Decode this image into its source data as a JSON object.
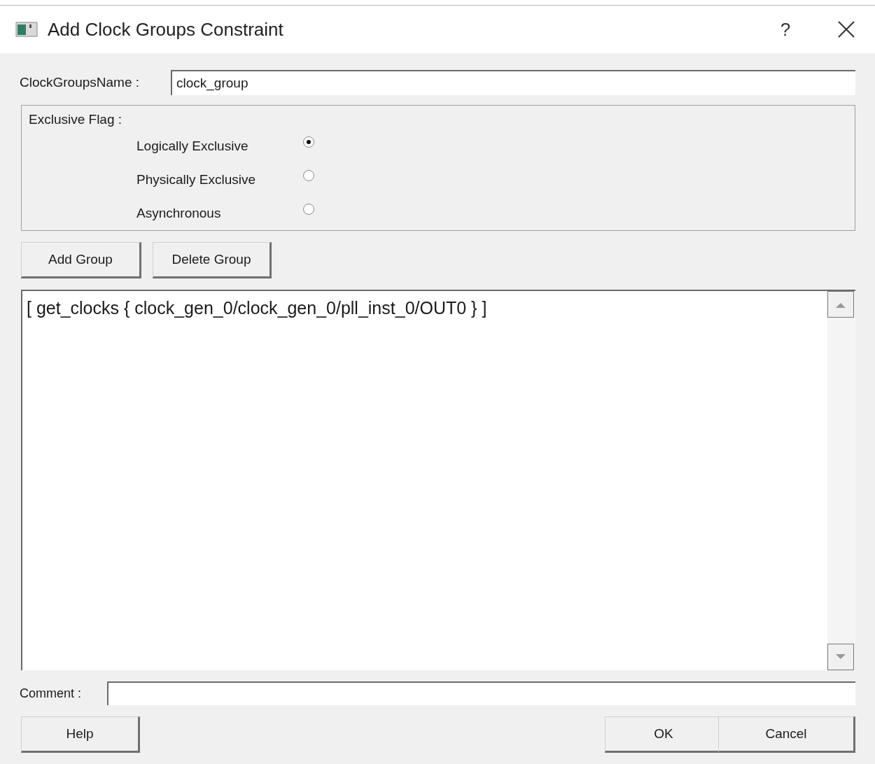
{
  "window": {
    "title": "Add Clock Groups Constraint",
    "help": "?"
  },
  "name_field": {
    "label": "ClockGroupsName :",
    "value": "clock_group"
  },
  "exclusive_flag": {
    "label": "Exclusive Flag :",
    "options": [
      {
        "label": "Logically Exclusive",
        "selected": true
      },
      {
        "label": "Physically Exclusive",
        "selected": false
      },
      {
        "label": "Asynchronous",
        "selected": false
      }
    ]
  },
  "group_buttons": [
    "Add Group",
    "Delete Group"
  ],
  "groups": [
    "[ get_clocks { clock_gen_0/clock_gen_0/pll_inst_0/OUT0 } ]"
  ],
  "comment_field": {
    "label": "Comment :"
  },
  "buttons": {
    "left": [
      "Help"
    ],
    "right": [
      "OK",
      "Cancel"
    ]
  }
}
